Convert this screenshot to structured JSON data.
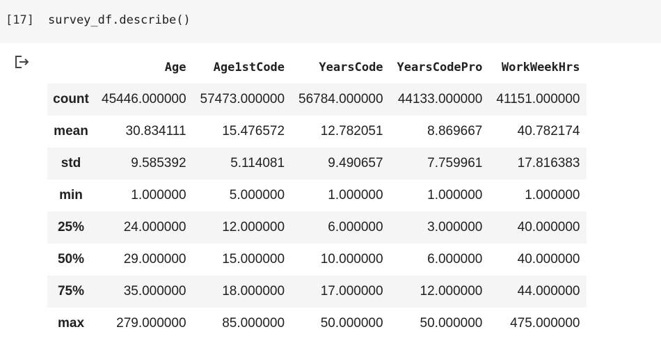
{
  "cell": {
    "execution_count": "[17]",
    "code": "survey_df.describe()"
  },
  "output": {
    "icon": "output-arrow-icon",
    "columns": [
      "Age",
      "Age1stCode",
      "YearsCode",
      "YearsCodePro",
      "WorkWeekHrs"
    ],
    "rows": [
      {
        "label": "count",
        "values": [
          "45446.000000",
          "57473.000000",
          "56784.000000",
          "44133.000000",
          "41151.000000"
        ]
      },
      {
        "label": "mean",
        "values": [
          "30.834111",
          "15.476572",
          "12.782051",
          "8.869667",
          "40.782174"
        ]
      },
      {
        "label": "std",
        "values": [
          "9.585392",
          "5.114081",
          "9.490657",
          "7.759961",
          "17.816383"
        ]
      },
      {
        "label": "min",
        "values": [
          "1.000000",
          "5.000000",
          "1.000000",
          "1.000000",
          "1.000000"
        ]
      },
      {
        "label": "25%",
        "values": [
          "24.000000",
          "12.000000",
          "6.000000",
          "3.000000",
          "40.000000"
        ]
      },
      {
        "label": "50%",
        "values": [
          "29.000000",
          "15.000000",
          "10.000000",
          "6.000000",
          "40.000000"
        ]
      },
      {
        "label": "75%",
        "values": [
          "35.000000",
          "18.000000",
          "17.000000",
          "12.000000",
          "44.000000"
        ]
      },
      {
        "label": "max",
        "values": [
          "279.000000",
          "85.000000",
          "50.000000",
          "50.000000",
          "475.000000"
        ]
      }
    ]
  }
}
